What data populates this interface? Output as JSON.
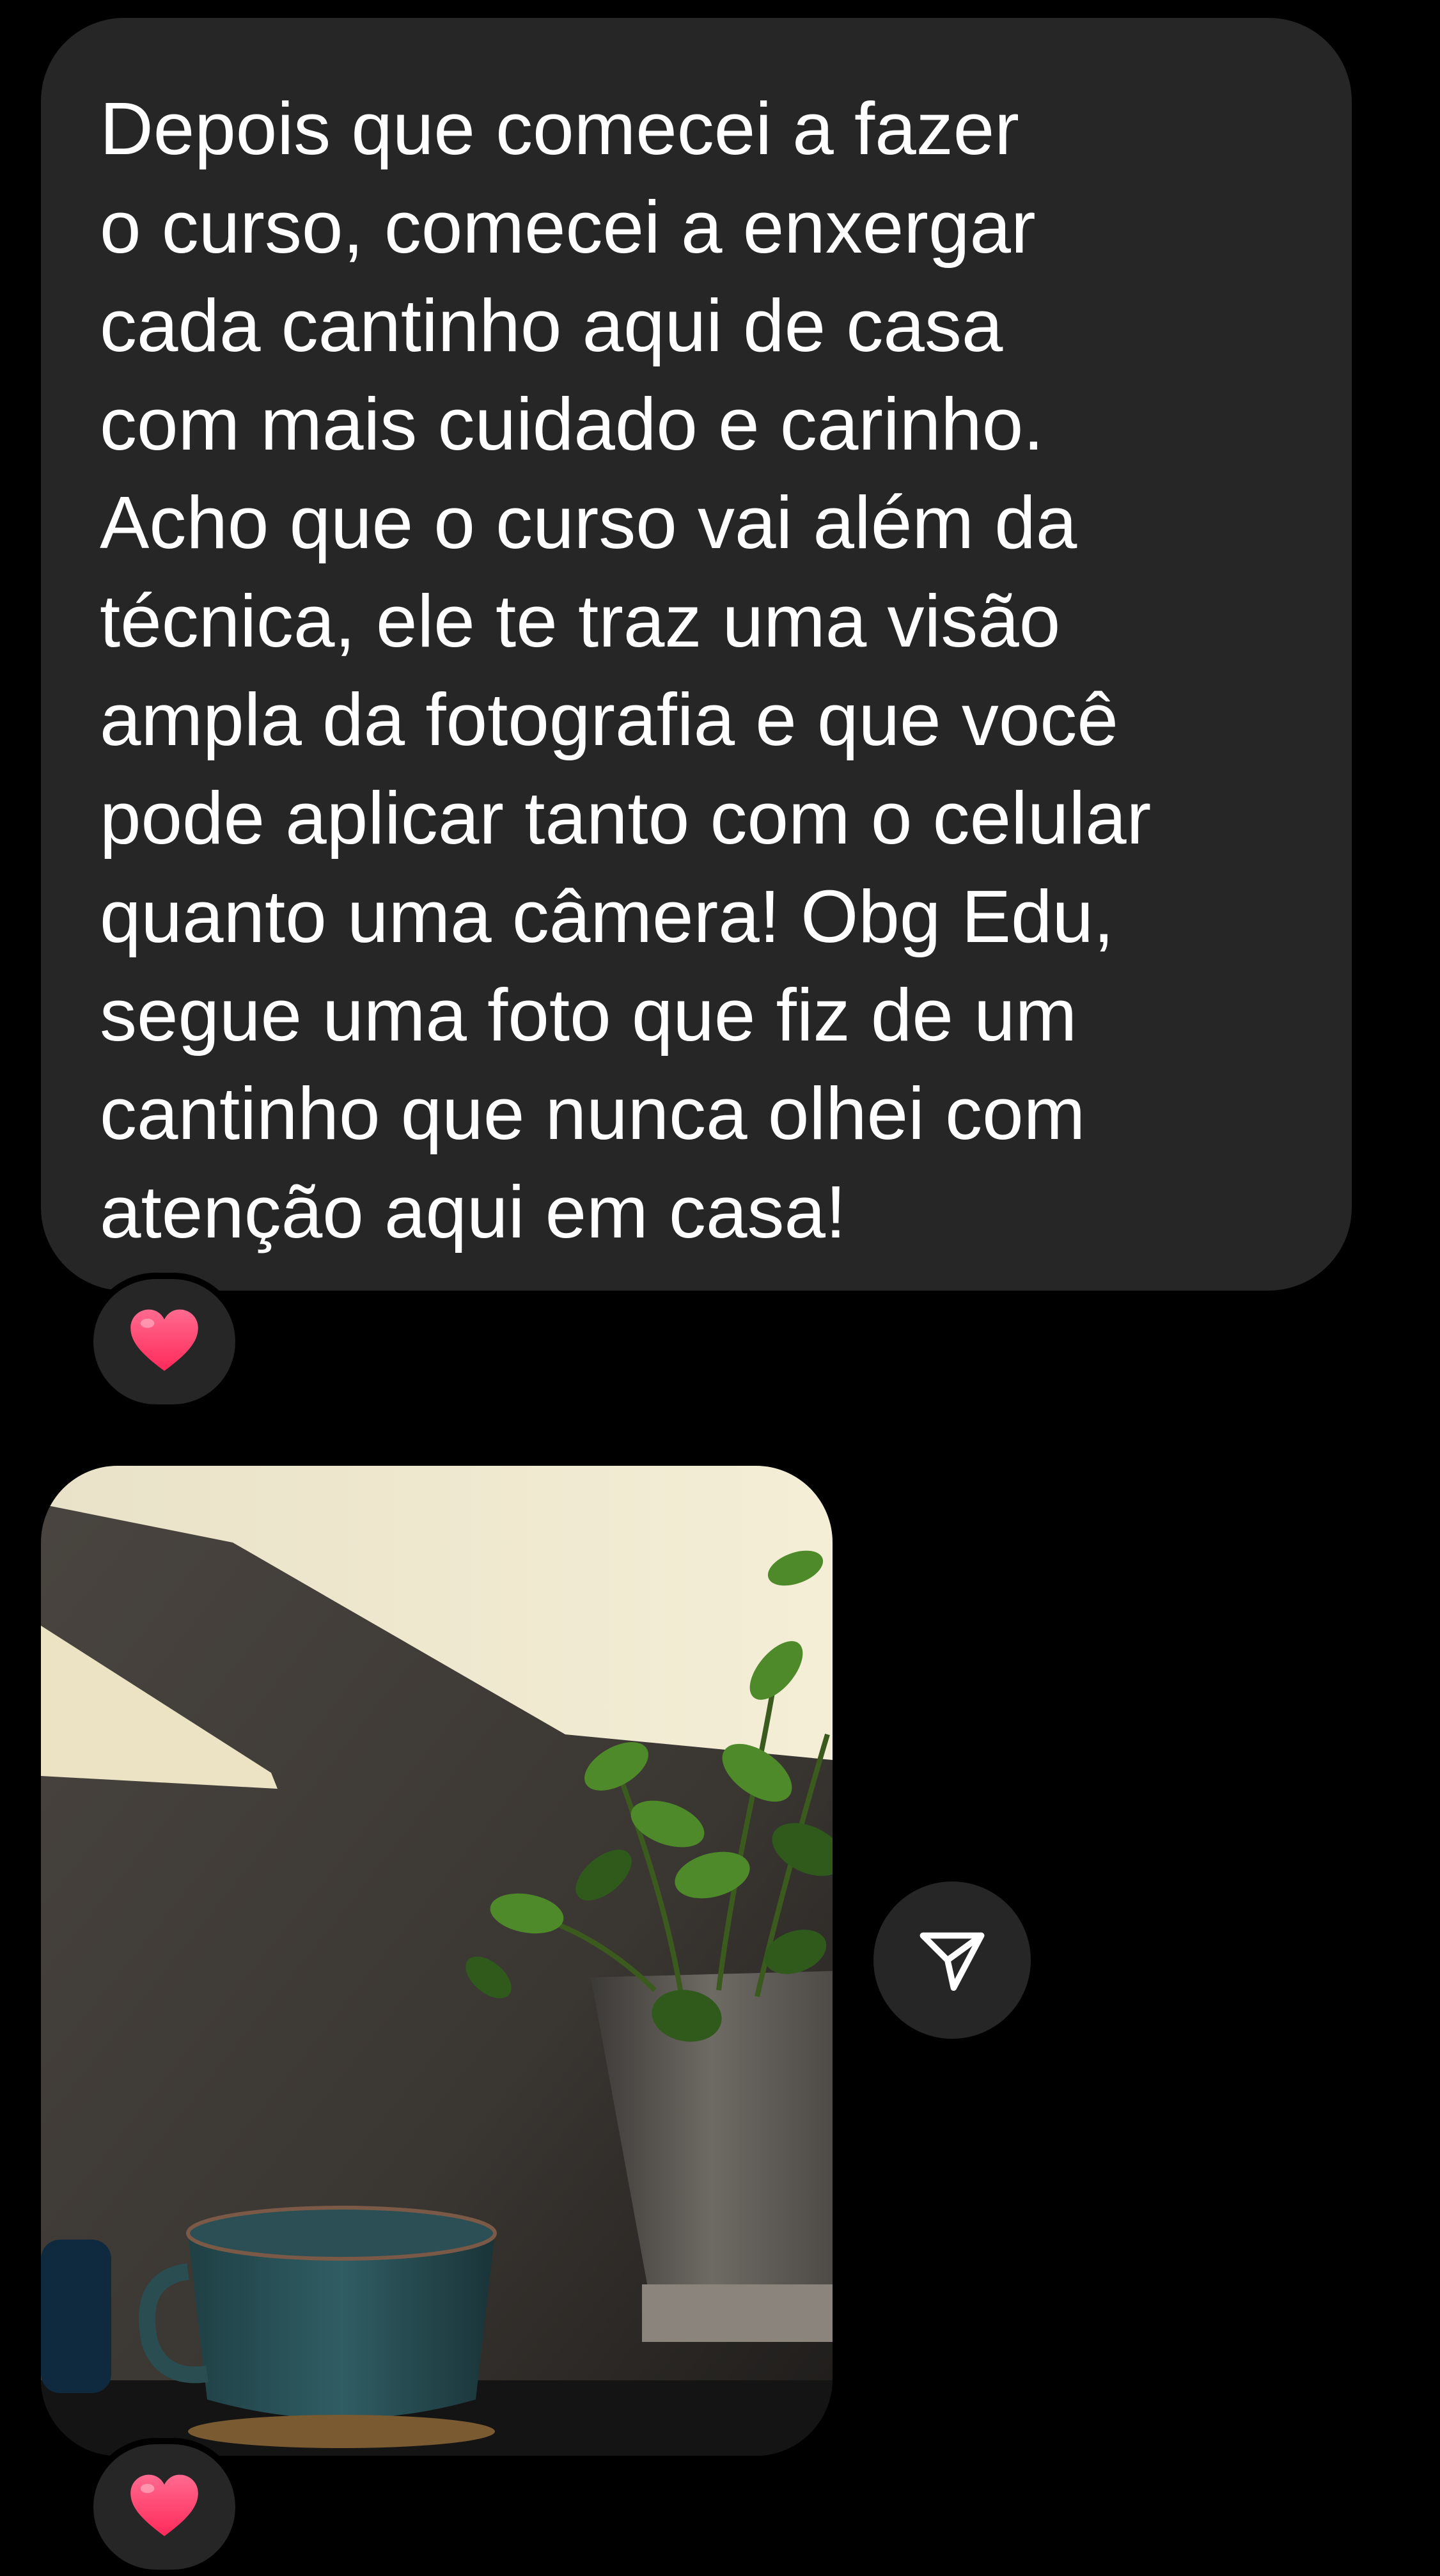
{
  "message": {
    "text": "Depois que comecei a fazer\no curso, comecei a enxergar\ncada cantinho aqui de casa\ncom mais cuidado e carinho.\nAcho que o curso vai além da\ntécnica, ele te traz uma visão\nampla da fotografia e que você\npode aplicar tanto com o celular\nquanto uma câmera! Obg Edu,\nsegue uma foto que fiz de um\ncantinho que nunca olhei com\natenção aqui em casa!",
    "reaction_icon": "heart-icon"
  },
  "photo_message": {
    "icon": "photo",
    "reaction_icon": "heart-icon"
  },
  "share": {
    "icon": "send-icon"
  },
  "colors": {
    "background": "#000000",
    "bubble": "#262626",
    "text": "#ffffff",
    "heart": "#ff3b6b"
  }
}
